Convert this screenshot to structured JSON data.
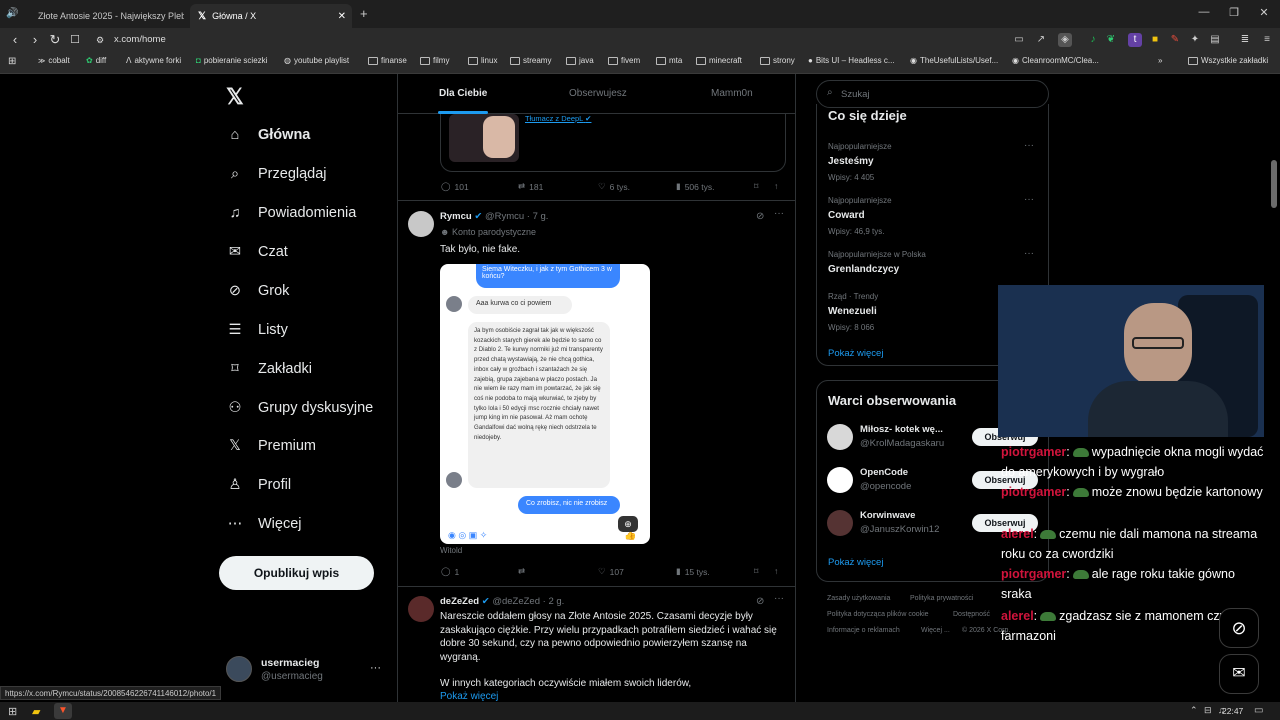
{
  "browser": {
    "tabs": [
      {
        "label": "Złote Antosie 2025 - Największy Pleb",
        "active": false
      },
      {
        "label": "Główna / X",
        "active": true
      }
    ],
    "url": "x.com/home",
    "bookmarks": [
      "cobalt",
      "diff",
      "aktywne forki",
      "pobieranie sciezki",
      "youtube playlist",
      "finanse",
      "filmy",
      "linux",
      "streamy",
      "java",
      "fivem",
      "mta",
      "minecraft",
      "strony",
      "Bits UI – Headless c...",
      "TheUsefulLists/Usef...",
      "CleanroomMC/Clea...",
      "Wszystkie zakładki"
    ],
    "status_url": "https://x.com/Rymcu/status/2008546226741146012/photo/1"
  },
  "sidebar": {
    "items": [
      {
        "label": "Główna",
        "icon": "home-icon",
        "active": true
      },
      {
        "label": "Przeglądaj",
        "icon": "search-icon"
      },
      {
        "label": "Powiadomienia",
        "icon": "bell-icon"
      },
      {
        "label": "Czat",
        "icon": "mail-icon"
      },
      {
        "label": "Grok",
        "icon": "grok-icon"
      },
      {
        "label": "Listy",
        "icon": "list-icon"
      },
      {
        "label": "Zakładki",
        "icon": "bookmark-icon"
      },
      {
        "label": "Grupy dyskusyjne",
        "icon": "people-icon"
      },
      {
        "label": "Premium",
        "icon": "x-logo-icon"
      },
      {
        "label": "Profil",
        "icon": "person-icon"
      },
      {
        "label": "Więcej",
        "icon": "more-circle-icon"
      }
    ],
    "post_button": "Opublikuj wpis",
    "account": {
      "name": "usermacieg",
      "handle": "@usermacieg"
    }
  },
  "feed": {
    "tabs": [
      "Dla Ciebie",
      "Obserwujesz",
      "Mamm0n"
    ],
    "prev_post": {
      "translate_link": "Tłumacz z DeepL",
      "stats": {
        "replies": "101",
        "reposts": "181",
        "likes": "6 tys.",
        "views": "506 tys."
      }
    },
    "post1": {
      "name": "Rymcu",
      "handle": "@Rymcu",
      "time": "7 g.",
      "label": "Konto parodystyczne",
      "text": "Tak było, nie fake.",
      "image": {
        "bubble_top": "Siema Witeczku, i jak z tym Gothicem 3 w końcu?",
        "reply_short": "Aaa kurwa co ci powiem",
        "reply_long": "Ja bym osobiście zagrał tak jak w większość kozackich starych gierek ale będzie to samo co z Diablo 2. Te kurwy normiki już mi transparenty przed chatą wystawiają, że nie chcą gothica, inbox cały w groźbach i szantażach że się zajebią, grupa zajebana w płaczo postach. Ja nie wiem ile razy mam im powtarzać, że jak się coś nie podoba to mają wkurwiać, te zjeby by tylko lola i 50 edycji msc rocznie chciały nawet jump king im nie pasował. Aż mam ochotę Gandalfowi dać wolną rękę niech odstrzela te niedojeby.",
        "bubble_bottom": "Co zrobisz, nic nie zrobisz"
      },
      "caption": "Witold",
      "stats": {
        "replies": "1",
        "reposts": "",
        "likes": "107",
        "views": "15 tys."
      }
    },
    "post2": {
      "name": "deZeZed",
      "handle": "@deZeZed",
      "time": "2 g.",
      "text": "Nareszcie oddałem głosy na Złote Antosie 2025. Czasami decyzje były zaskakująco ciężkie. Przy wielu przypadkach potrafiłem siedzieć i wahać się dobre 30 sekund, czy na pewno odpowiednio powierzyłem szansę na wygraną.",
      "text2": "W innych kategoriach oczywiście miałem swoich liderów,",
      "more": "Pokaż więcej"
    }
  },
  "right": {
    "search_placeholder": "Szukaj",
    "trends_title": "Co się dzieje",
    "trends": [
      {
        "cat": "Najpopularniejsze",
        "name": "Jesteśmy",
        "count": "Wpisy: 4 405"
      },
      {
        "cat": "Najpopularniejsze",
        "name": "Coward",
        "count": "Wpisy: 46,9 tys."
      },
      {
        "cat": "Najpopularniejsze w Polska",
        "name": "Grenlandczycy",
        "count": ""
      },
      {
        "cat": "Rząd · Trendy",
        "name": "Wenezueli",
        "count": "Wpisy: 8 066"
      }
    ],
    "show_more": "Pokaż więcej",
    "wtf_title": "Warci obserwowania",
    "follow_label": "Obserwuj",
    "suggestions": [
      {
        "name": "Miłosz- kotek wę...",
        "handle": "@KrolMadagaskaru"
      },
      {
        "name": "OpenCode",
        "handle": "@opencode"
      },
      {
        "name": "Korwinwave",
        "handle": "@JanuszKorwin12"
      }
    ],
    "footer": [
      "Zasady użytkowania",
      "Polityka prywatności",
      "Polityka dotycząca plików cookie",
      "Dostępność",
      "Informacje o reklamach",
      "Więcej ...",
      "© 2026 X Corp."
    ]
  },
  "chat": [
    {
      "user": "piotrgamer",
      "text": "wypadnięcie okna mogli wydać do amerykowych i by wygrało"
    },
    {
      "user": "piotrgamer",
      "text": "może znowu będzie kartonowy"
    },
    {
      "user": "alerel",
      "text": "czemu nie dali mamona na streama roku co za cwordziki"
    },
    {
      "user": "piotrgamer",
      "text": "ale rage roku takie gówno sraka"
    },
    {
      "user": "alerel",
      "text": "zgadzasz sie z mamonem czy farmazoni"
    }
  ],
  "taskbar": {
    "time": "22:47"
  }
}
